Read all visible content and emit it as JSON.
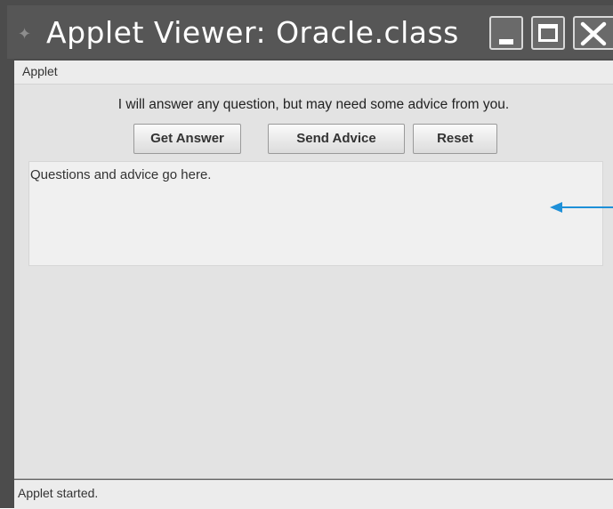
{
  "window": {
    "title": "Applet Viewer: Oracle.class",
    "icons": [
      "applet-window-icon",
      "minimize-icon",
      "maximize-icon",
      "close-icon"
    ]
  },
  "menubar": {
    "items": [
      "Applet"
    ]
  },
  "main": {
    "prompt": "I will answer any question, but may need some advice from you.",
    "buttons": {
      "get_answer": "Get Answer",
      "send_advice": "Send Advice",
      "reset": "Reset"
    },
    "textarea": {
      "value": "Questions and advice go here."
    },
    "annotation_arrow": {
      "icon": "arrow-left-icon",
      "color": "#1e90d8"
    }
  },
  "statusbar": {
    "text": "Applet started."
  },
  "colors": {
    "titlebar": "#565656",
    "panel": "#e3e3e3",
    "textarea": "#f0f0f0",
    "annotation": "#1e90d8"
  }
}
